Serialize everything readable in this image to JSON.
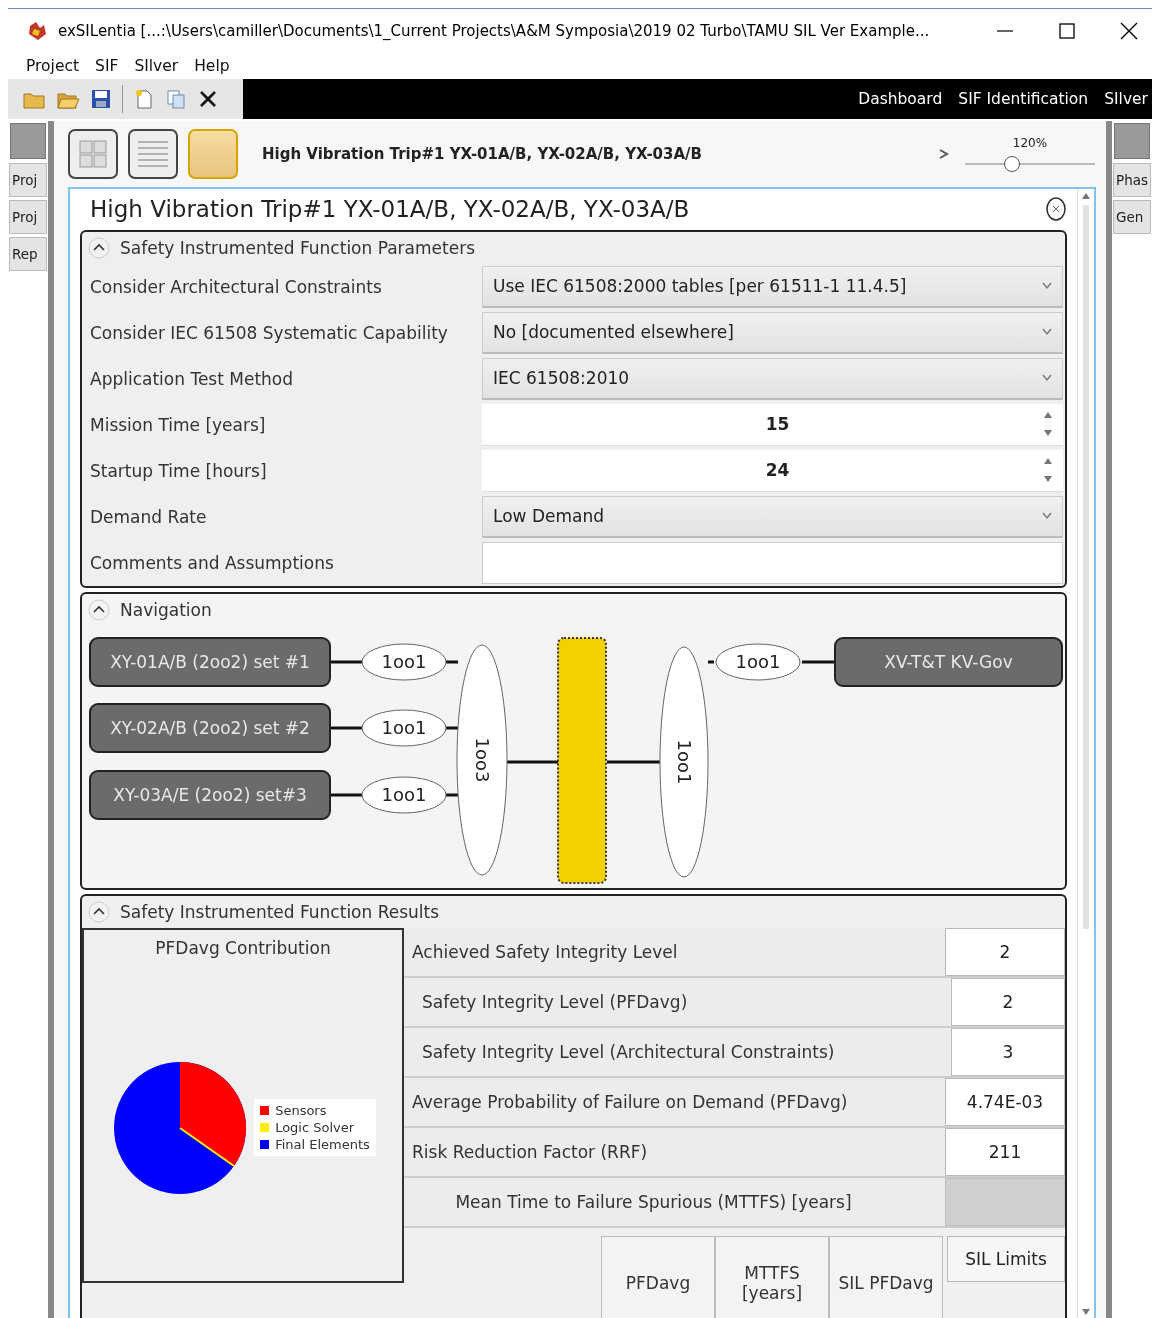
{
  "window": {
    "title": "exSILentia [...:\\Users\\camiller\\Documents\\1_Current Projects\\A&M Symposia\\2019 02 Turbo\\TAMU SIL Ver Example..."
  },
  "menu": [
    "Project",
    "SIF",
    "SIlver",
    "Help"
  ],
  "nav_links": [
    "Dashboard",
    "SIF Identification",
    "SIlver"
  ],
  "left_tabs": [
    "Proj",
    "Proj",
    "Rep"
  ],
  "right_tabs": [
    "Phas",
    "Gen"
  ],
  "header": {
    "title": "High Vibration Trip#1 YX-01A/B, YX-02A/B, YX-03A/B",
    "zoom": "120%",
    "level": 0.36
  },
  "sif": {
    "title": "High Vibration Trip#1 YX-01A/B, YX-02A/B, YX-03A/B",
    "parameters": {
      "title": "Safety Instrumented Function Parameters",
      "rows": [
        {
          "label": "Consider Architectural Constraints",
          "kind": "dropdown",
          "value": "Use IEC 61508:2000 tables [per 61511-1 11.4.5]"
        },
        {
          "label": "Consider IEC 61508 Systematic Capability",
          "kind": "dropdown",
          "value": "No [documented elsewhere]"
        },
        {
          "label": "Application Test Method",
          "kind": "dropdown",
          "value": "IEC 61508:2010"
        },
        {
          "label": "Mission Time [years]",
          "kind": "number",
          "value": "15"
        },
        {
          "label": "Startup Time [hours]",
          "kind": "number",
          "value": "24"
        },
        {
          "label": "Demand Rate",
          "kind": "dropdown",
          "value": "Low Demand"
        },
        {
          "label": "Comments and Assumptions",
          "kind": "text"
        }
      ]
    },
    "navigation": {
      "title": "Navigation",
      "sensors": [
        {
          "name": "XY-01A/B (2oo2) set #1",
          "vote": "1oo1"
        },
        {
          "name": "XY-02A/B (2oo2) set #2",
          "vote": "1oo1"
        },
        {
          "name": "XY-03A/E (2oo2) set#3",
          "vote": "1oo1"
        }
      ],
      "sensor_vote": "1oo3",
      "final_vote": "1oo1",
      "final_elements": [
        {
          "name": "XV-T&T KV-Gov",
          "vote": "1oo1"
        }
      ]
    },
    "results": {
      "title": "Safety Instrumented Function Results",
      "chart_title": "PFDavg Contribution",
      "legend": [
        {
          "label": "Sensors",
          "color": "#ff0000"
        },
        {
          "label": "Logic Solver",
          "color": "#ffee00"
        },
        {
          "label": "Final Elements",
          "color": "#0000ff"
        }
      ],
      "rows": [
        {
          "label": "Achieved Safety Integrity Level",
          "value": "2",
          "children": [
            {
              "label": "Safety Integrity Level (PFDavg)",
              "value": "2"
            },
            {
              "label": "Safety Integrity Level (Architectural Constraints)",
              "value": "3"
            }
          ]
        },
        {
          "label": "Average Probability of Failure on Demand (PFDavg)",
          "value": "4.74E-03"
        },
        {
          "label": "Risk Reduction Factor (RRF)",
          "value": "211"
        },
        {
          "label": "Mean Time to Failure Spurious (MTTFS) [years]",
          "disabled": true
        }
      ],
      "columns": [
        "PFDavg",
        "MTTFS [years]",
        "SIL PFDavg"
      ],
      "sil_limits": {
        "title": "SIL Limits"
      }
    }
  }
}
